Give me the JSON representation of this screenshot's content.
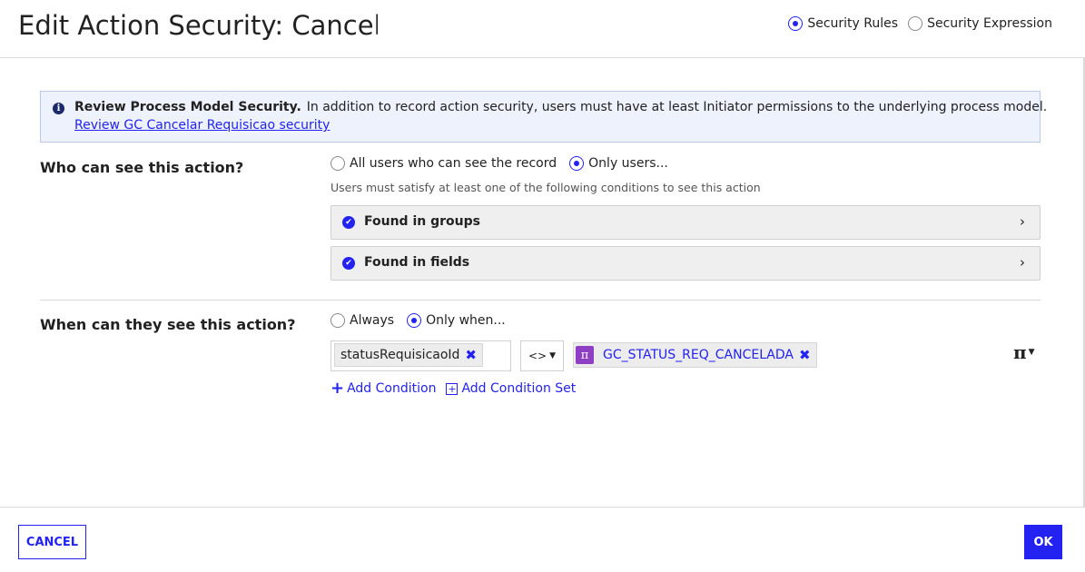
{
  "dialog": {
    "title": "Edit Action Security: Cancel"
  },
  "mode_options": [
    {
      "label": "Security Rules",
      "selected": true
    },
    {
      "label": "Security Expression",
      "selected": false
    }
  ],
  "banner": {
    "icon": "info-icon",
    "heading": "Review Process Model Security.",
    "text": "In addition to record action security, users must have at least Initiator permissions to the underlying process model.",
    "link": "Review GC Cancelar Requisicao security"
  },
  "who": {
    "label": "Who can see this action?",
    "options": [
      {
        "label": "All users who can see the record",
        "selected": false
      },
      {
        "label": "Only users...",
        "selected": true
      }
    ],
    "hint": "Users must satisfy at least one of the following conditions to see this action",
    "conditions": [
      {
        "label": "Found in groups"
      },
      {
        "label": "Found in fields"
      }
    ]
  },
  "when": {
    "label": "When can they see this action?",
    "options": [
      {
        "label": "Always",
        "selected": false
      },
      {
        "label": "Only when...",
        "selected": true
      }
    ],
    "condition": {
      "field": "statusRequisicaoId",
      "operator": "<>",
      "value": "GC_STATUS_REQ_CANCELADA",
      "value_icon": "pi-icon",
      "remove_symbol": "✖"
    },
    "expression_symbol": "π",
    "add_condition": "Add Condition",
    "add_condition_set": "Add Condition Set"
  },
  "footer": {
    "cancel": "CANCEL",
    "ok": "OK"
  },
  "colors": {
    "accent": "#2322f0",
    "banner_bg": "#edf2fc",
    "pi_badge": "#8e3fc4"
  }
}
